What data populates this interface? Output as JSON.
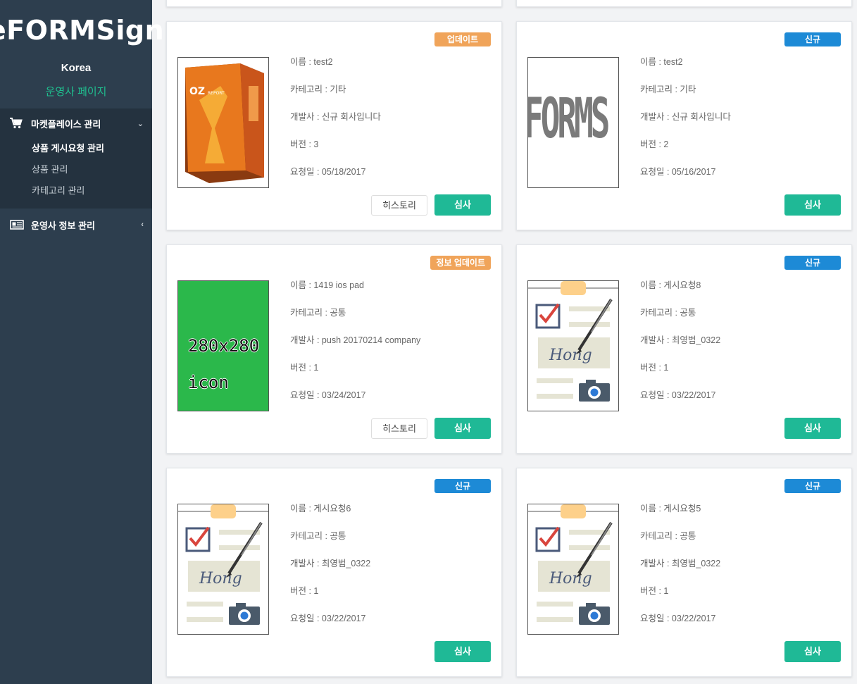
{
  "sidebar": {
    "logo": "eFORMSign",
    "region": "Korea",
    "operator_page": "운영사 페이지",
    "menu": [
      {
        "label": "마켓플레이스 관리",
        "icon": "cart-icon",
        "expanded": true,
        "items": [
          {
            "label": "상품 게시요청 관리",
            "active": true
          },
          {
            "label": "상품 관리",
            "active": false
          },
          {
            "label": "카테고리 관리",
            "active": false
          }
        ]
      },
      {
        "label": "운영사 정보 관리",
        "icon": "newspaper-icon",
        "expanded": false,
        "items": []
      }
    ]
  },
  "buttons": {
    "review": "심사",
    "history": "히스토리"
  },
  "colors": {
    "sidebar_bg": "#2d3e4e",
    "accent_green": "#1fb996",
    "badge_new": "#1d8ad6",
    "badge_update": "#f0a45a"
  },
  "cards": [
    {
      "badge": "업데이트",
      "badge_type": "update",
      "thumb": "oz-report-box",
      "name": "이름 : test2",
      "category": "카테고리 : 기타",
      "developer": "개발사 : 신규 회사입니다",
      "version": "버전 : 3",
      "requested": "요청일 : 05/18/2017",
      "has_history": true
    },
    {
      "badge": "신규",
      "badge_type": "new",
      "thumb": "forms-text",
      "thumb_text": "FORMS",
      "name": "이름 : test2",
      "category": "카테고리 : 기타",
      "developer": "개발사 : 신규 회사입니다",
      "version": "버전 : 2",
      "requested": "요청일 : 05/16/2017",
      "has_history": false
    },
    {
      "badge": "정보 업데이트",
      "badge_type": "update",
      "thumb": "green-placeholder",
      "thumb_line1": "280x280",
      "thumb_line2": "icon",
      "name": "이름 : 1419 ios pad",
      "category": "카테고리 : 공통",
      "developer": "개발사 : push 20170214 company",
      "version": "버전 : 1",
      "requested": "요청일 : 03/24/2017",
      "has_history": true
    },
    {
      "badge": "신규",
      "badge_type": "new",
      "thumb": "signature-doc",
      "thumb_sign": "Hong",
      "name": "이름 : 게시요청8",
      "category": "카테고리 : 공통",
      "developer": "개발사 : 최영범_0322",
      "version": "버전 : 1",
      "requested": "요청일 : 03/22/2017",
      "has_history": false
    },
    {
      "badge": "신규",
      "badge_type": "new",
      "thumb": "signature-doc",
      "thumb_sign": "Hong",
      "name": "이름 : 게시요청6",
      "category": "카테고리 : 공통",
      "developer": "개발사 : 최영범_0322",
      "version": "버전 : 1",
      "requested": "요청일 : 03/22/2017",
      "has_history": false
    },
    {
      "badge": "신규",
      "badge_type": "new",
      "thumb": "signature-doc",
      "thumb_sign": "Hong",
      "name": "이름 : 게시요청5",
      "category": "카테고리 : 공통",
      "developer": "개발사 : 최영범_0322",
      "version": "버전 : 1",
      "requested": "요청일 : 03/22/2017",
      "has_history": false
    }
  ]
}
